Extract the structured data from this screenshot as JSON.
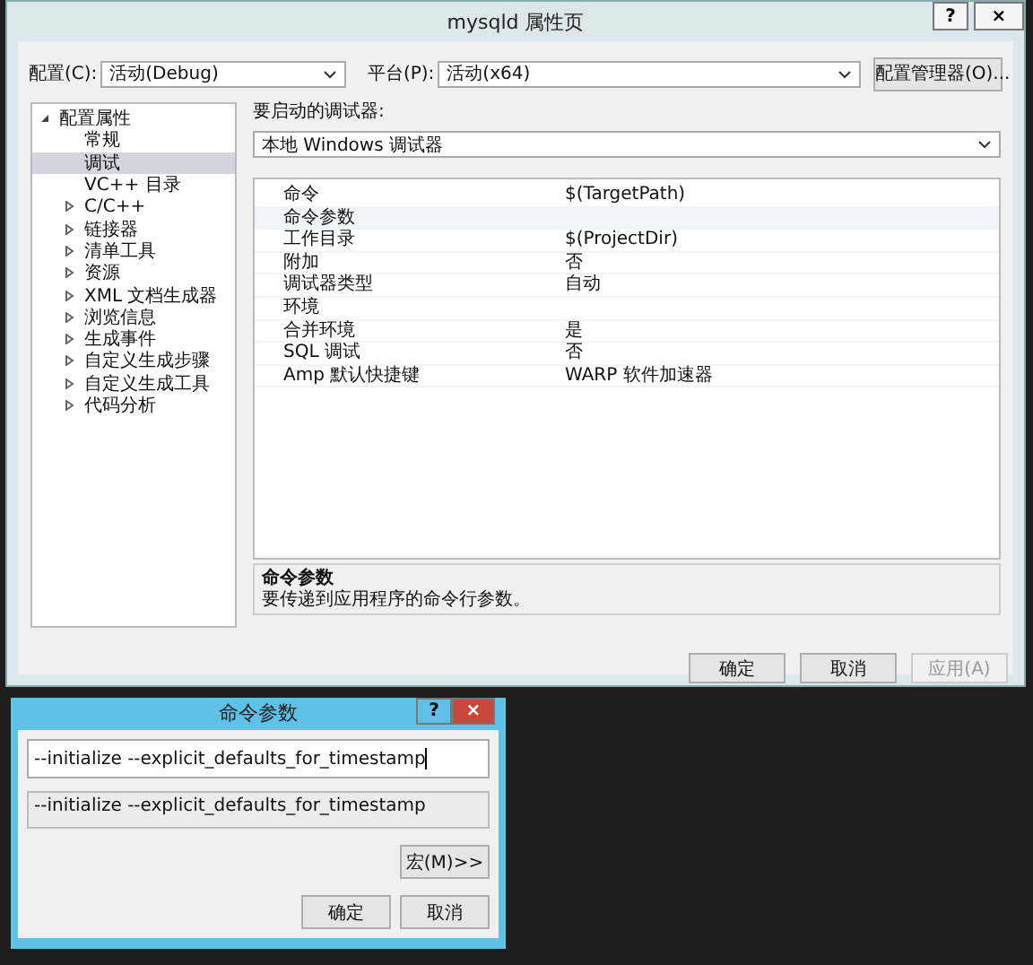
{
  "window": {
    "title": "mysqld 属性页",
    "help": "?",
    "close": "×"
  },
  "toolbar": {
    "config_label": "配置(C):",
    "config_value": "活动(Debug)",
    "platform_label": "平台(P):",
    "platform_value": "活动(x64)",
    "manager_button": "配置管理器(O)..."
  },
  "tree": [
    {
      "label": "配置属性",
      "kind": "group",
      "expanded": true,
      "children": [
        {
          "label": "常规",
          "kind": "page",
          "selected": false
        },
        {
          "label": "调试",
          "kind": "page",
          "selected": true
        },
        {
          "label": "VC++ 目录",
          "kind": "page",
          "selected": false
        },
        {
          "label": "C/C++",
          "kind": "group",
          "expanded": false,
          "selected": false
        },
        {
          "label": "链接器",
          "kind": "group",
          "expanded": false,
          "selected": false
        },
        {
          "label": "清单工具",
          "kind": "group",
          "expanded": false,
          "selected": false
        },
        {
          "label": "资源",
          "kind": "group",
          "expanded": false,
          "selected": false
        },
        {
          "label": "XML 文档生成器",
          "kind": "group",
          "expanded": false,
          "selected": false
        },
        {
          "label": "浏览信息",
          "kind": "group",
          "expanded": false,
          "selected": false
        },
        {
          "label": "生成事件",
          "kind": "group",
          "expanded": false,
          "selected": false
        },
        {
          "label": "自定义生成步骤",
          "kind": "group",
          "expanded": false,
          "selected": false
        },
        {
          "label": "自定义生成工具",
          "kind": "group",
          "expanded": false,
          "selected": false
        },
        {
          "label": "代码分析",
          "kind": "group",
          "expanded": false,
          "selected": false
        }
      ]
    }
  ],
  "debugger": {
    "label": "要启动的调试器:",
    "value": "本地 Windows 调试器"
  },
  "properties": [
    {
      "name": "命令",
      "value": "$(TargetPath)",
      "selected": false
    },
    {
      "name": "命令参数",
      "selected": true
    },
    {
      "name": "工作目录",
      "value": "$(ProjectDir)",
      "selected": false
    },
    {
      "name": "附加",
      "value": "否",
      "selected": false
    },
    {
      "name": "调试器类型",
      "value": "自动",
      "selected": false
    },
    {
      "name": "环境",
      "selected": false
    },
    {
      "name": "合并环境",
      "value": "是",
      "selected": false
    },
    {
      "name": "SQL 调试",
      "value": "否",
      "selected": false
    },
    {
      "name": "Amp 默认快捷键",
      "value": "WARP 软件加速器",
      "selected": false
    }
  ],
  "description": {
    "title": "命令参数",
    "text": "要传递到应用程序的命令行参数。"
  },
  "buttons": [
    {
      "label": "确定",
      "disabled": false
    },
    {
      "label": "取消",
      "disabled": false
    },
    {
      "label": "应用(A)",
      "disabled": true
    }
  ],
  "dialog": {
    "title": "命令参数",
    "help": "?",
    "close": "×",
    "value": "--initialize --explicit_defaults_for_timestamp",
    "preview": "--initialize --explicit_defaults_for_timestamp",
    "macro_button": "宏(M)>>",
    "buttons": [
      "确定",
      "取消"
    ]
  }
}
